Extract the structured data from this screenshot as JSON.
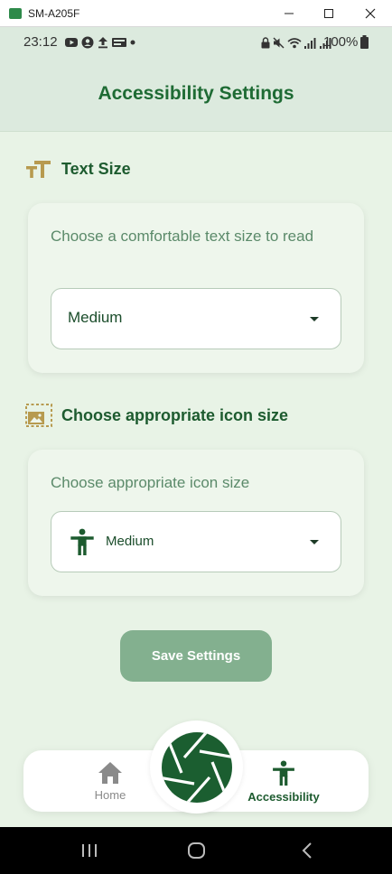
{
  "window": {
    "title": "SM-A205F",
    "app_icon_text": "scrcpy"
  },
  "status_bar": {
    "time": "23:12",
    "battery": "100%"
  },
  "app_bar": {
    "title": "Accessibility Settings"
  },
  "text_size": {
    "header": "Text Size",
    "description": "Choose a comfortable text size to read",
    "selected": "Medium"
  },
  "icon_size": {
    "header": "Choose appropriate icon size",
    "description": "Choose appropriate icon size",
    "selected": "Medium"
  },
  "save_button": {
    "label": "Save Settings"
  },
  "bottom_nav": {
    "home_label": "Home",
    "accessibility_label": "Accessibility"
  },
  "colors": {
    "primary": "#1e6b34",
    "background": "#e8f3e6",
    "accent_gold": "#b79a4f",
    "button": "#83b08f"
  }
}
